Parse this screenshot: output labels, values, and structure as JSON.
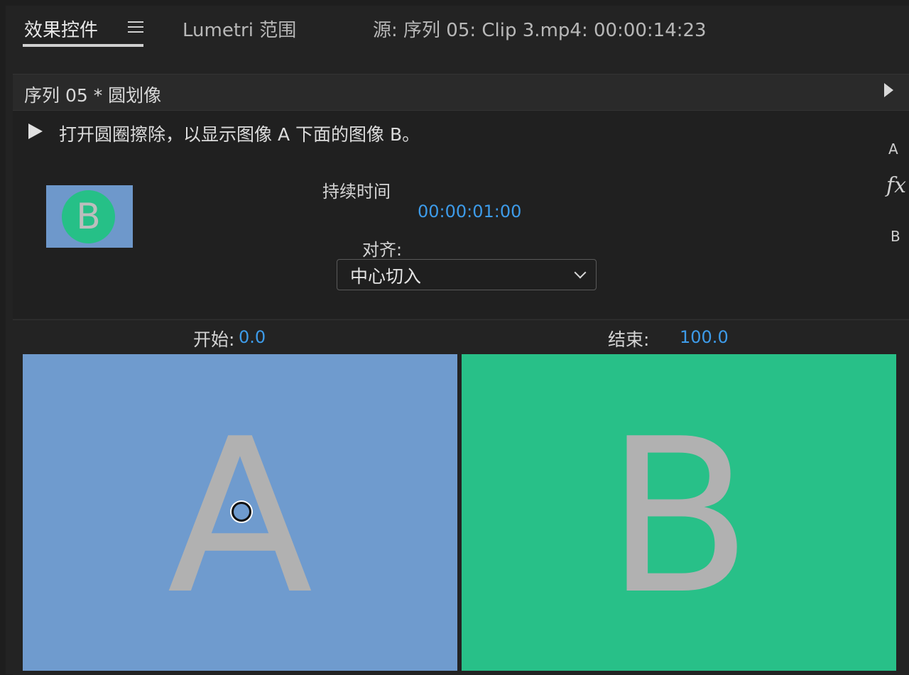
{
  "tabs": {
    "effect_controls": "效果控件",
    "lumetri_scopes": "Lumetri 范围",
    "source": "源: 序列 05: Clip 3.mp4: 00:00:14:23"
  },
  "sequence": {
    "title": "序列 05 * 圆划像"
  },
  "effect": {
    "description": "打开圆圈擦除，以显示图像 A 下面的图像 B。",
    "thumbnail_letter": "B",
    "duration_label": "持续时间",
    "duration_value": "00:00:01:00",
    "align_label": "对齐:",
    "align_selected": "中心切入",
    "side_a": "A",
    "side_fx": "fx",
    "side_b": "B"
  },
  "preview": {
    "start_label": "开始:",
    "start_value": "0.0",
    "end_label": "结束:",
    "end_value": "100.0",
    "pane_a_letter": "A",
    "pane_b_letter": "B"
  },
  "colors": {
    "accent_blue": "#3d9be9",
    "pane_a": "#6f9bce",
    "pane_b": "#28c088"
  }
}
